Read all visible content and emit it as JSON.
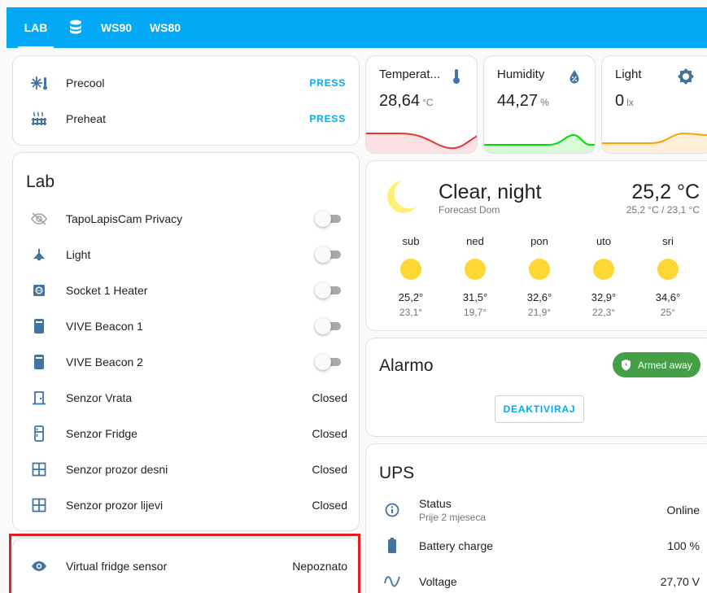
{
  "tabs": [
    {
      "label": "LAB",
      "active": true
    },
    {
      "icon": "database-icon"
    },
    {
      "label": "WS90"
    },
    {
      "label": "WS80"
    }
  ],
  "buttons_card": {
    "items": [
      {
        "icon": "snowflake-thermometer-icon",
        "label": "Precool",
        "action": "PRESS"
      },
      {
        "icon": "radiator-icon",
        "label": "Preheat",
        "action": "PRESS"
      }
    ]
  },
  "lab": {
    "title": "Lab",
    "items": [
      {
        "icon": "eye-off-icon",
        "label": "TapoLapisCam Privacy",
        "type": "toggle",
        "on": false
      },
      {
        "icon": "ceiling-light-icon",
        "label": "Light",
        "type": "toggle",
        "on": false
      },
      {
        "icon": "socket-icon",
        "label": "Socket 1 Heater",
        "type": "toggle",
        "on": false
      },
      {
        "icon": "beacon-icon",
        "label": "VIVE Beacon 1",
        "type": "toggle",
        "on": false
      },
      {
        "icon": "beacon-icon",
        "label": "VIVE Beacon 2",
        "type": "toggle",
        "on": false
      },
      {
        "icon": "door-icon",
        "label": "Senzor Vrata",
        "type": "state",
        "value": "Closed"
      },
      {
        "icon": "fridge-icon",
        "label": "Senzor Fridge",
        "type": "state",
        "value": "Closed"
      },
      {
        "icon": "window-icon",
        "label": "Senzor prozor desni",
        "type": "state",
        "value": "Closed"
      },
      {
        "icon": "window-icon",
        "label": "Senzor prozor lijevi",
        "type": "state",
        "value": "Closed"
      }
    ]
  },
  "virtual": {
    "icon": "eye-icon",
    "label": "Virtual fridge sensor",
    "value": "Nepoznato"
  },
  "sensors": [
    {
      "name": "Temperat...",
      "value": "28,64",
      "unit": "°C",
      "icon": "thermometer-icon",
      "graph_color": "#e53935"
    },
    {
      "name": "Humidity",
      "value": "44,27",
      "unit": "%",
      "icon": "water-percent-icon",
      "graph_color": "#00e000"
    },
    {
      "name": "Light",
      "value": "0",
      "unit": "lx",
      "icon": "brightness-icon",
      "graph_color": "#ffa000"
    }
  ],
  "weather": {
    "condition": "Clear, night",
    "source": "Forecast Dom",
    "temp": "25,2 °C",
    "range": "25,2 °C / 23,1 °C",
    "forecast": [
      {
        "day": "sub",
        "hi": "25,2°",
        "lo": "23,1°"
      },
      {
        "day": "ned",
        "hi": "31,5°",
        "lo": "19,7°"
      },
      {
        "day": "pon",
        "hi": "32,6°",
        "lo": "21,9°"
      },
      {
        "day": "uto",
        "hi": "32,9°",
        "lo": "22,3°"
      },
      {
        "day": "sri",
        "hi": "34,6°",
        "lo": "25°"
      }
    ]
  },
  "alarmo": {
    "title": "Alarmo",
    "state": "Armed away",
    "button": "DEAKTIVIRAJ"
  },
  "ups": {
    "title": "UPS",
    "items": [
      {
        "icon": "info-icon",
        "label": "Status",
        "sub": "Prije 2 mjeseca",
        "value": "Online"
      },
      {
        "icon": "battery-icon",
        "label": "Battery charge",
        "value": "100 %"
      },
      {
        "icon": "sine-wave-icon",
        "label": "Voltage",
        "value": "27,70 V"
      }
    ]
  },
  "colors": {
    "accent": "#03a9f4",
    "icon": "#44739e",
    "armed": "#43a047",
    "highlight": "#e31e24"
  }
}
